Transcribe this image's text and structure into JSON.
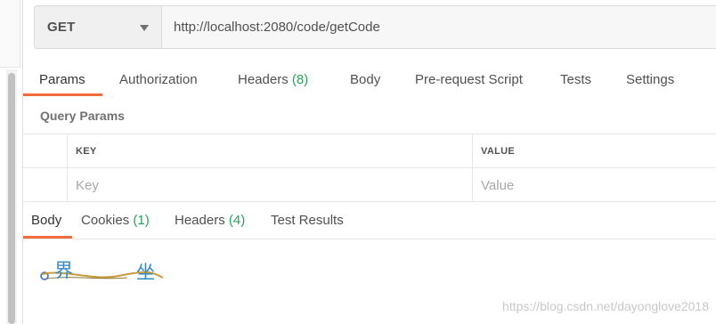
{
  "request": {
    "method": "GET",
    "url": "http://localhost:2080/code/getCode"
  },
  "request_tabs": [
    {
      "label": "Params",
      "count": "",
      "active": true
    },
    {
      "label": "Authorization",
      "count": "",
      "active": false
    },
    {
      "label": "Headers",
      "count": "(8)",
      "active": false
    },
    {
      "label": "Body",
      "count": "",
      "active": false
    },
    {
      "label": "Pre-request Script",
      "count": "",
      "active": false
    },
    {
      "label": "Tests",
      "count": "",
      "active": false
    },
    {
      "label": "Settings",
      "count": "",
      "active": false
    }
  ],
  "query_params": {
    "title": "Query Params",
    "columns": {
      "key": "KEY",
      "value": "VALUE"
    },
    "placeholders": {
      "key": "Key",
      "value": "Value"
    }
  },
  "response_tabs": [
    {
      "label": "Body",
      "count": "",
      "active": true
    },
    {
      "label": "Cookies",
      "count": "(1)",
      "active": false
    },
    {
      "label": "Headers",
      "count": "(4)",
      "active": false
    },
    {
      "label": "Test Results",
      "count": "",
      "active": false
    }
  ],
  "response_body": {
    "captcha_chars": [
      "界",
      "坐"
    ]
  },
  "watermark": "https://blog.csdn.net/dayonglove2018",
  "colors": {
    "accent": "#f26b3a",
    "count": "#26a35a",
    "captcha_text": "#2e8bc9",
    "captcha_line": "#c89a3a"
  }
}
